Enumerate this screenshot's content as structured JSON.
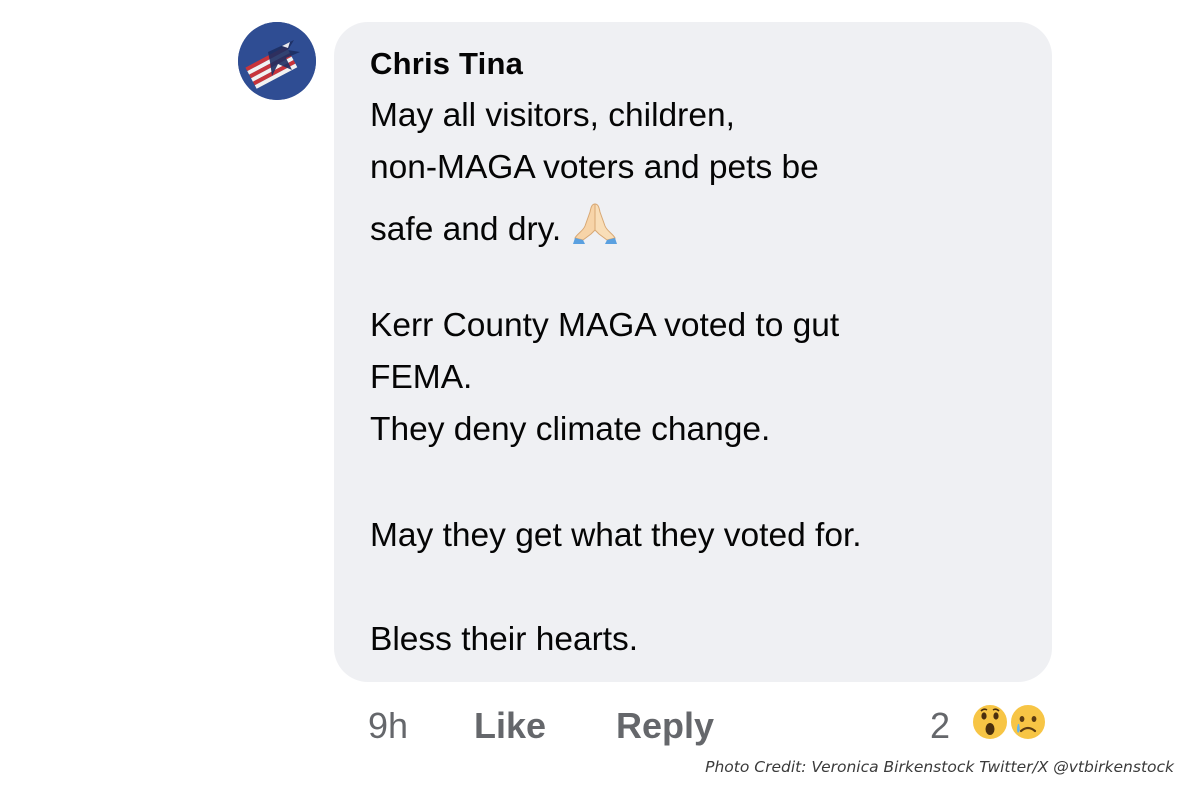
{
  "comment": {
    "author": "Chris Tina",
    "lines": [
      "May all visitors, children,",
      "non-MAGA voters and pets be",
      "safe and dry.",
      "Kerr County MAGA voted to gut",
      "FEMA.",
      "They deny climate change.",
      "May they get what they voted for.",
      "Bless their hearts."
    ],
    "emoji": "folded-hands-icon",
    "bubble_color": "#eff0f3",
    "text_color": "#050505"
  },
  "actions": {
    "time": "9h",
    "like_label": "Like",
    "reply_label": "Reply",
    "meta_color": "#65676b"
  },
  "reactions": {
    "count": "2",
    "icons": [
      "wow-face-icon",
      "sad-face-icon"
    ]
  },
  "credit": "Photo Credit: Veronica Birkenstock Twitter/X @vtbirkenstock"
}
